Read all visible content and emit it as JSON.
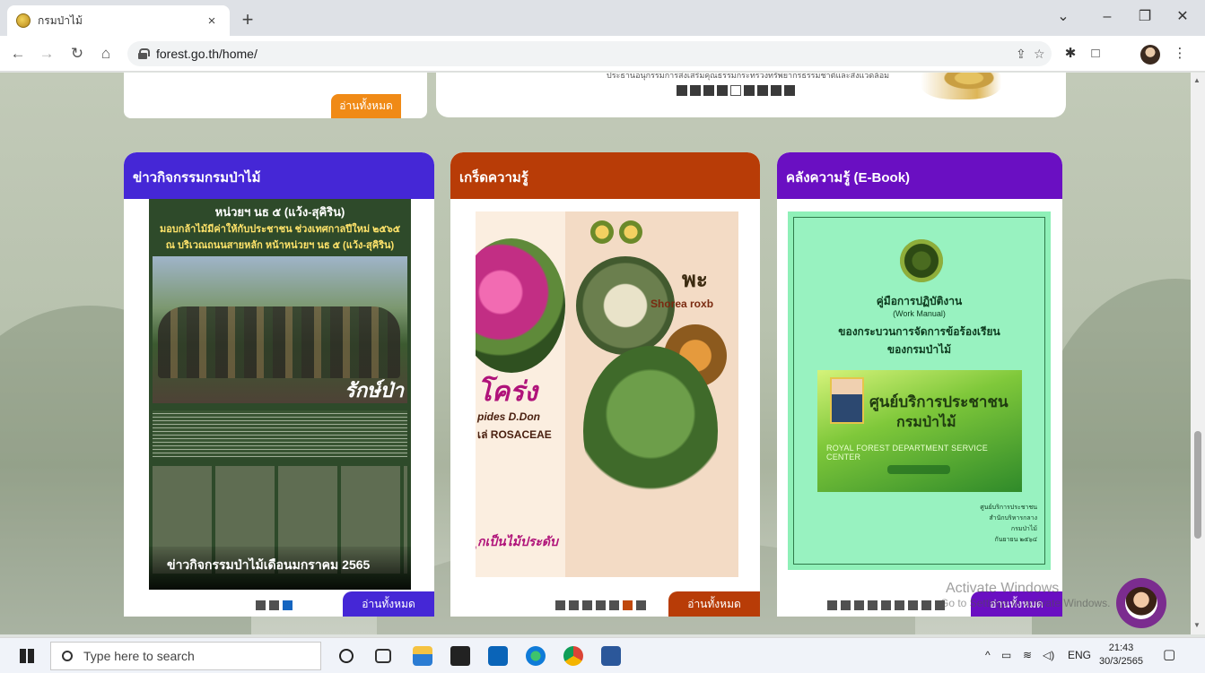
{
  "browser": {
    "tab_title": "กรมป่าไม้",
    "tab_close": "×",
    "new_tab": "+",
    "url": "forest.go.th/home/"
  },
  "top": {
    "left_readmore": "อ่านทั้งหมด",
    "right_caption": "ประธานอนุกรรมการส่งเสริมคุณธรรมกระทรวงทรัพยากรธรรมชาติและสิ่งแวดล้อม"
  },
  "cards": {
    "news": {
      "header": "ข่าวกิจกรรมกรมป่าไม้",
      "header_color": "#4527d6",
      "headline1": "หน่วยฯ นธ ๕ (แว้ง-สุคิริน)",
      "headline2": "มอบกล้าไม้มีค่าให้กับประชาชน ช่วงเทศกาลปีใหม่ ๒๕๖๕",
      "headline3": "ณ บริเวณถนนสายหลัก หน้าหน่วยฯ นธ ๕ (แว้ง-สุคิริน)",
      "brand": "รักษ์ป่า",
      "caption": "ข่าวกิจกรรมป่าไม้เดือนมกราคม 2565",
      "readmore": "อ่านทั้งหมด"
    },
    "tips": {
      "header": "เกร็ดความรู้",
      "header_color": "#b83c07",
      "big1": "พะ",
      "big2": "Shorea roxb",
      "thai_name": "โคร่ง",
      "sci_name": "pides D.Don",
      "family": "เล่ ROSACEAE",
      "footer": "ุกเป็นไม้ประดับ",
      "readmore": "อ่านทั้งหมด"
    },
    "ebook": {
      "header": "คลังความรู้ (E-Book)",
      "header_color": "#6a0fc2",
      "title1": "คู่มือการปฏิบัติงาน",
      "title2": "(Work Manual)",
      "title3": "ของกระบวนการจัดการข้อร้องเรียน",
      "title4": "ของกรมป่าไม้",
      "banner1": "ศูนย์บริการประชาชน",
      "banner2": "กรมป่าไม้",
      "banner3": "ROYAL FOREST DEPARTMENT SERVICE CENTER",
      "side1": "ศูนย์บริการประชาชน",
      "side2": "สำนักบริหารกลาง",
      "side3": "กรมป่าไม้",
      "side4": "กันยายน ๒๕๖๔",
      "readmore": "อ่านทั้งหมด"
    }
  },
  "watermark": {
    "line1": "Activate Windows",
    "line2": "Go to Settings to activate Windows."
  },
  "taskbar": {
    "search_placeholder": "Type here to search",
    "lang": "ENG",
    "time": "21:43",
    "date": "30/3/2565"
  },
  "icons": [
    "back-arrow-icon",
    "forward-arrow-icon",
    "reload-icon",
    "home-icon",
    "lock-icon",
    "share-icon",
    "star-icon",
    "extension-icon",
    "sidepanel-icon",
    "profile-icon",
    "menu-icon",
    "windows-icon",
    "search-icon",
    "cortana-icon",
    "task-view-icon",
    "file-explorer-icon",
    "store-icon",
    "mail-icon",
    "edge-icon",
    "chrome-icon",
    "word-icon",
    "chevron-up-icon",
    "network-icon",
    "wifi-icon",
    "volume-icon",
    "notification-icon"
  ],
  "colors": {
    "readmore_orange": "#f08a16",
    "readmore_news": "#4527d6",
    "readmore_tips": "#b83c07",
    "readmore_ebook": "#6a0fc2"
  }
}
